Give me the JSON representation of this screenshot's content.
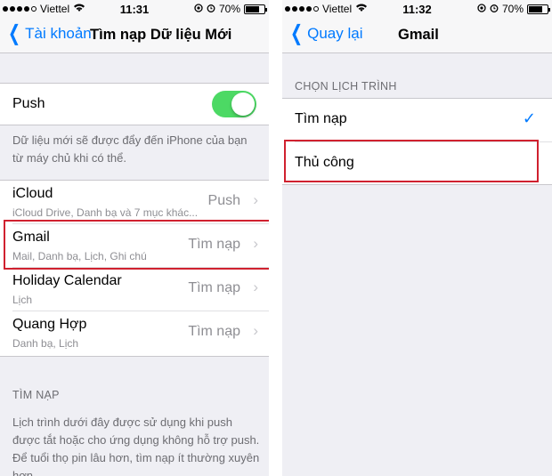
{
  "left": {
    "status": {
      "carrier": "Viettel",
      "time": "11:31",
      "battery": "70%"
    },
    "nav": {
      "back_label": "Tài khoản",
      "title": "Tìm nạp Dữ liệu Mới"
    },
    "push": {
      "label": "Push",
      "enabled": true
    },
    "push_footer": "Dữ liệu mới sẽ được đẩy đến iPhone của bạn từ máy chủ khi có thể.",
    "accounts": [
      {
        "name": "iCloud",
        "detail": "iCloud Drive, Danh bạ và 7 mục khác...",
        "value": "Push"
      },
      {
        "name": "Gmail",
        "detail": "Mail, Danh bạ, Lịch, Ghi chú",
        "value": "Tìm nạp"
      },
      {
        "name": "Holiday Calendar",
        "detail": "Lịch",
        "value": "Tìm nạp"
      },
      {
        "name": "Quang Hợp",
        "detail": "Danh bạ, Lịch",
        "value": "Tìm nạp"
      }
    ],
    "fetch_header": "TÌM NẠP",
    "fetch_footer": "Lịch trình dưới đây được sử dụng khi push được tắt hoặc cho ứng dụng không hỗ trợ push. Để tuổi thọ pin lâu hơn, tìm nạp ít thường xuyên hơn."
  },
  "right": {
    "status": {
      "carrier": "Viettel",
      "time": "11:32",
      "battery": "70%"
    },
    "nav": {
      "back_label": "Quay lại",
      "title": "Gmail"
    },
    "schedule_header": "CHỌN LỊCH TRÌNH",
    "options": [
      {
        "label": "Tìm nạp",
        "selected": true
      },
      {
        "label": "Thủ công",
        "selected": false
      }
    ]
  },
  "colors": {
    "accent": "#007aff",
    "toggle_on": "#4cd964",
    "highlight": "#d0212f"
  }
}
